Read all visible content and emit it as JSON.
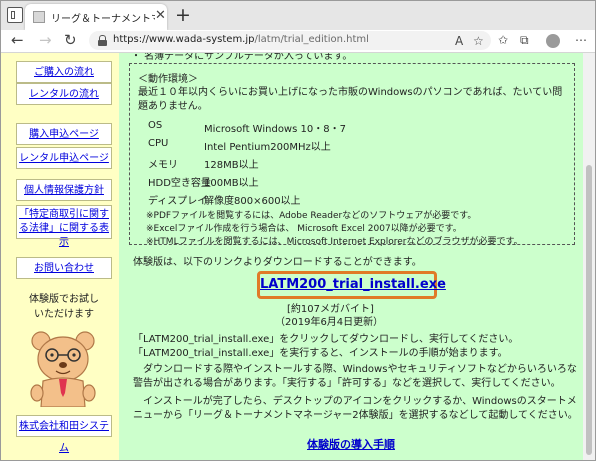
{
  "browser": {
    "tab_title": "リーグ＆トーナメントマネージャー 体験",
    "url_main": "https://www.wada-system.jp",
    "url_path": "/latm/trial_edition.html"
  },
  "sidebar": {
    "links": [
      "ご購入の流れ",
      "レンタルの流れ",
      "購入申込ページ",
      "レンタル申込ページ",
      "個人情報保護方針",
      "「特定商取引に関する法律」に関する表示",
      "お問い合わせ"
    ],
    "mascot_caption": [
      "体験版でお試し",
      "いただけます"
    ],
    "company": "株式会社和田システム"
  },
  "main": {
    "top_line": "・ 名簿データにサンプルデータが入っています。",
    "env_heading": "＜動作環境＞",
    "env_intro": "最近１０年以内くらいにお買い上げになった市販のWindowsのパソコンであれば、たいてい問題ありません。",
    "specs": [
      {
        "k": "OS",
        "v": "Microsoft Windows 10・8・7"
      },
      {
        "k": "CPU",
        "v": "Intel Pentium200MHz以上"
      },
      {
        "k": "メモリ",
        "v": "128MB以上"
      },
      {
        "k": "HDD空き容量",
        "v": "100MB以上"
      },
      {
        "k": "ディスプレイ",
        "v": "解像度800×600以上"
      }
    ],
    "notes": [
      "※PDFファイルを閲覧するには、Adobe Readerなどのソフトウェアが必要です。",
      "※Excelファイル作成を行う場合は、 Microsoft Excel 2007以降が必要です。",
      "※HTMLファイルを閲覧するには、Microsoft Internet Explorerなどのブラウザが必要です。"
    ],
    "download_intro": "体験版は、以下のリンクよりダウンロードすることができます。",
    "download_link": "LATM200_trial_install.exe",
    "file_size": "[約107メガバイト]",
    "updated": "（2019年6月4日更新）",
    "para1": [
      "「LATM200_trial_install.exe」をクリックしてダウンロードし、実行してください。",
      "「LATM200_trial_install.exe」を実行すると、インストールの手順が始まります。"
    ],
    "para2": "　ダウンロードする際やインストールする際、Windowsやセキュリティソフトなどからいろいろな警告が出される場合があります。「実行する」「許可する」などを選択して、実行してください。",
    "para3": "　インストールが完了したら、デスクトップのアイコンをクリックするか、Windowsのスタートメニューから「リーグ＆トーナメントマネージャー2体験版」を選択するなどして起動してください。",
    "guide_link": "体験版の導入手順"
  }
}
